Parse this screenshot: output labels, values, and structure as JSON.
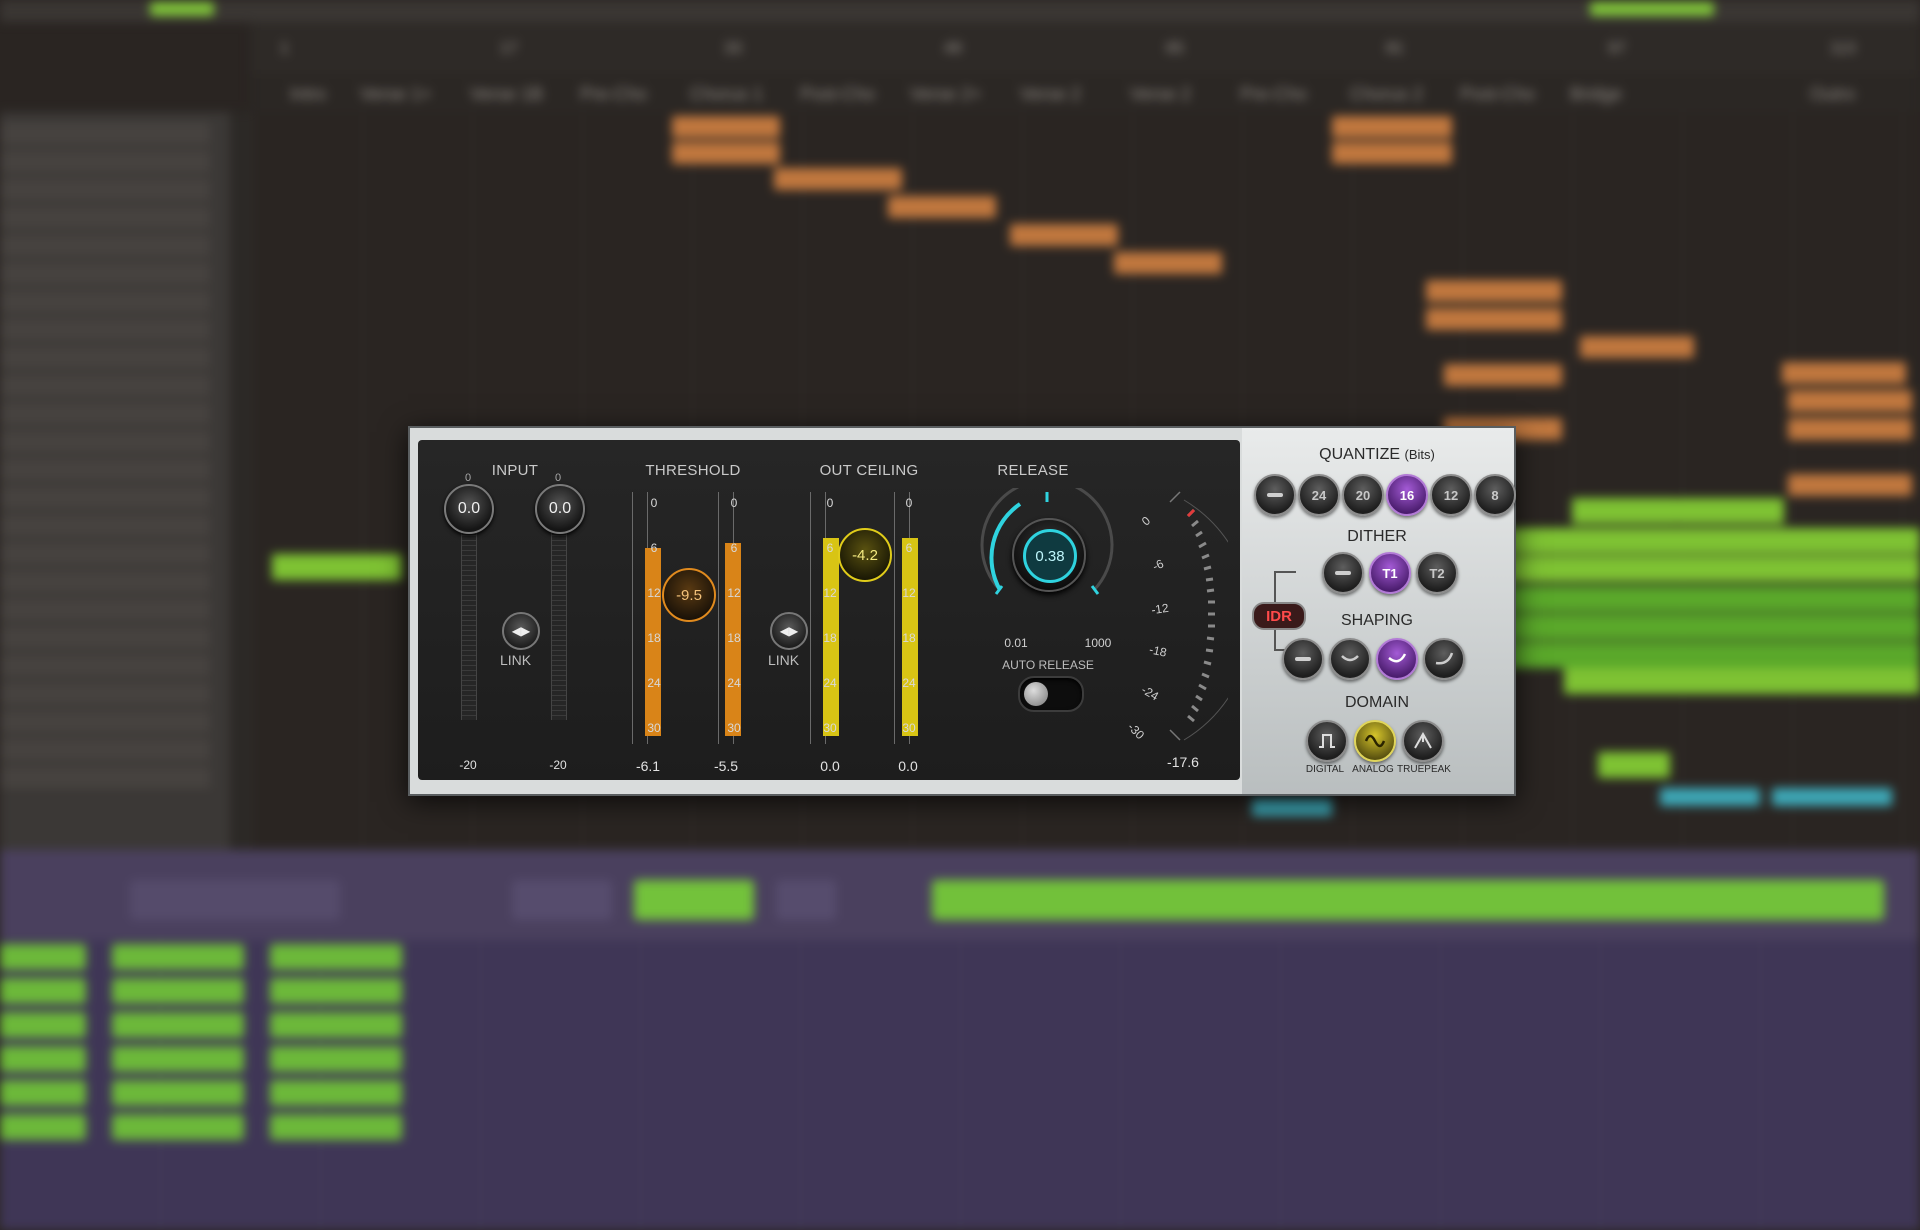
{
  "background": {
    "ruler_numbers": [
      "1",
      "17",
      "33",
      "49",
      "65",
      "81",
      "97",
      "113"
    ],
    "marker_labels": [
      "Intro",
      "Verse 1+",
      "Verse 1B",
      "Pre-Cho",
      "Chorus 1",
      "Post-Cho",
      "Verse 2+",
      "Verse 2",
      "Verse 2",
      "Pre-Cho",
      "Chorus 2",
      "Post-Cho",
      "Bridge",
      "Outro"
    ]
  },
  "plugin": {
    "input": {
      "label": "INPUT",
      "left": {
        "top_label": "0",
        "value": "0.0",
        "bottom_label": "-20"
      },
      "right": {
        "top_label": "0",
        "value": "0.0",
        "bottom_label": "-20"
      },
      "link_label": "LINK"
    },
    "threshold": {
      "label": "THRESHOLD",
      "value": "-9.5",
      "scale": [
        "0",
        "6",
        "12",
        "18",
        "24",
        "30"
      ],
      "left_readout": "-6.1",
      "right_readout": "-5.5",
      "left_level_db": -6.1,
      "right_level_db": -5.5,
      "link_label": "LINK"
    },
    "out_ceiling": {
      "label": "OUT CEILING",
      "value": "-4.2",
      "scale": [
        "0",
        "6",
        "12",
        "18",
        "24",
        "30"
      ],
      "left_readout": "0.0",
      "right_readout": "0.0"
    },
    "release": {
      "label": "RELEASE",
      "value": "0.38",
      "min_label": "0.01",
      "max_label": "1000",
      "auto_release_label": "AUTO RELEASE",
      "auto_release_on": false
    },
    "gr_meter": {
      "scale": [
        "0",
        "-6",
        "-12",
        "-18",
        "-24",
        "-30"
      ],
      "readout": "-17.6"
    },
    "quantize": {
      "label": "QUANTIZE",
      "sublabel": "(Bits)",
      "options": [
        "—",
        "24",
        "20",
        "16",
        "12",
        "8"
      ],
      "selected": "16"
    },
    "dither": {
      "label": "DITHER",
      "options": [
        "—",
        "T1",
        "T2"
      ],
      "selected": "T1",
      "idr_label": "IDR"
    },
    "shaping": {
      "label": "SHAPING",
      "selected_index": 2
    },
    "domain": {
      "label": "DOMAIN",
      "options": [
        "DIGITAL",
        "ANALOG",
        "TRUEPEAK"
      ],
      "selected": "ANALOG"
    },
    "colors": {
      "threshold_accent": "#e08a1e",
      "ceiling_accent": "#e0cc1a",
      "release_accent": "#2fd3df",
      "selected_purple": "#8e3fc4",
      "idr_red": "#e03030"
    }
  }
}
